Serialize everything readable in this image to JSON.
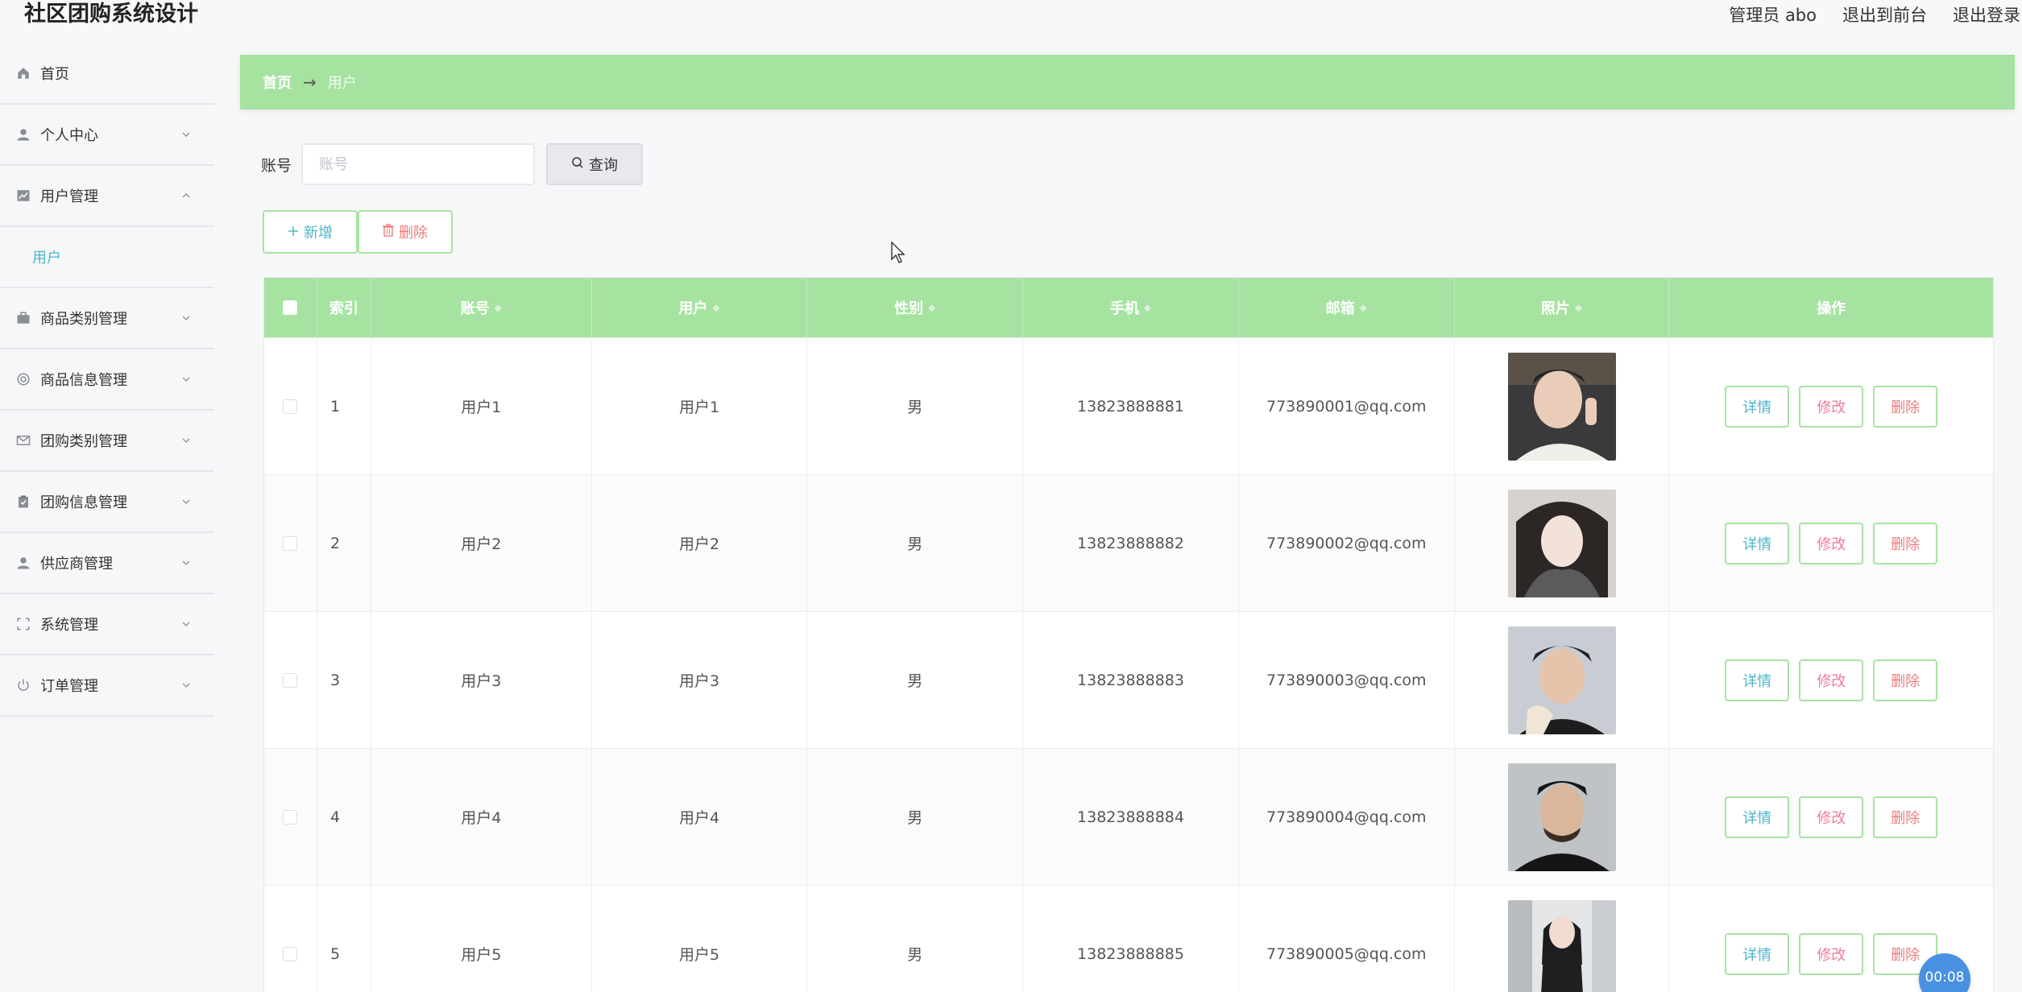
{
  "app": {
    "title": "社区团购系统设计",
    "admin_label": "管理员 abo",
    "to_frontend": "退出到前台",
    "logout": "退出登录"
  },
  "sidebar": {
    "items": [
      {
        "label": "首页",
        "icon": "home-icon",
        "has_arrow": false
      },
      {
        "label": "个人中心",
        "icon": "user-icon",
        "has_arrow": true,
        "expanded": false
      },
      {
        "label": "用户管理",
        "icon": "chart-icon",
        "has_arrow": true,
        "expanded": true
      },
      {
        "label": "商品类别管理",
        "icon": "briefcase-icon",
        "has_arrow": true,
        "expanded": false
      },
      {
        "label": "商品信息管理",
        "icon": "lifebuoy-icon",
        "has_arrow": true,
        "expanded": false
      },
      {
        "label": "团购类别管理",
        "icon": "mail-icon",
        "has_arrow": true,
        "expanded": false
      },
      {
        "label": "团购信息管理",
        "icon": "clipboard-icon",
        "has_arrow": true,
        "expanded": false
      },
      {
        "label": "供应商管理",
        "icon": "user-icon",
        "has_arrow": true,
        "expanded": false
      },
      {
        "label": "系统管理",
        "icon": "fullscreen-icon",
        "has_arrow": true,
        "expanded": false
      },
      {
        "label": "订单管理",
        "icon": "power-icon",
        "has_arrow": true,
        "expanded": false
      }
    ],
    "submenu_user": "用户"
  },
  "breadcrumb": {
    "home": "首页",
    "separator": "→",
    "current": "用户"
  },
  "search": {
    "label": "账号",
    "placeholder": "账号",
    "value": "",
    "button": "查询"
  },
  "actions": {
    "add": "新增",
    "delete": "删除"
  },
  "table": {
    "columns": [
      "索引",
      "账号",
      "用户",
      "性别",
      "手机",
      "邮箱",
      "照片",
      "操作"
    ],
    "rows": [
      {
        "index": "1",
        "account": "用户1",
        "user": "用户1",
        "gender": "男",
        "phone": "13823888881",
        "email": "773890001@qq.com"
      },
      {
        "index": "2",
        "account": "用户2",
        "user": "用户2",
        "gender": "男",
        "phone": "13823888882",
        "email": "773890002@qq.com"
      },
      {
        "index": "3",
        "account": "用户3",
        "user": "用户3",
        "gender": "男",
        "phone": "13823888883",
        "email": "773890003@qq.com"
      },
      {
        "index": "4",
        "account": "用户4",
        "user": "用户4",
        "gender": "男",
        "phone": "13823888884",
        "email": "773890004@qq.com"
      },
      {
        "index": "5",
        "account": "用户5",
        "user": "用户5",
        "gender": "男",
        "phone": "13823888885",
        "email": "773890005@qq.com"
      }
    ],
    "row_actions": {
      "detail": "详情",
      "edit": "修改",
      "delete": "删除"
    }
  },
  "timer": "00:08",
  "colors": {
    "accent_green": "#a6e3a1",
    "link_teal": "#4eb5c9",
    "danger_pink": "#ee7b7b"
  }
}
